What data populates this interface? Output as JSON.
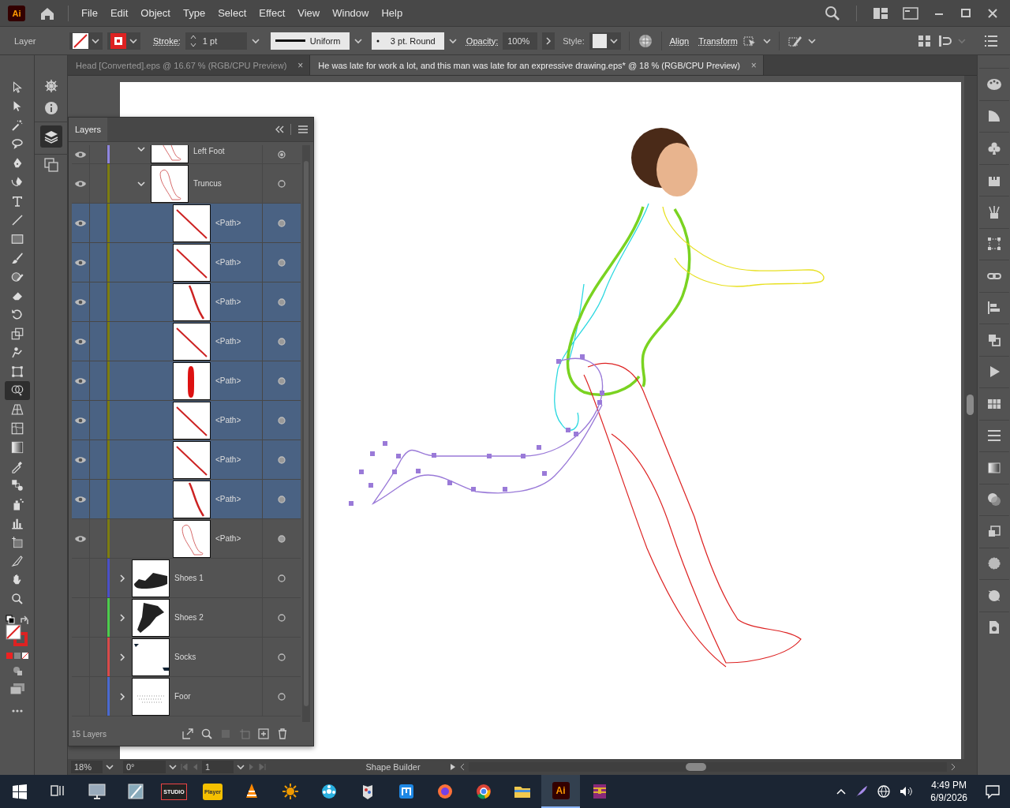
{
  "menu_bar": {
    "logo": "Ai",
    "items": [
      "File",
      "Edit",
      "Object",
      "Type",
      "Select",
      "Effect",
      "View",
      "Window",
      "Help"
    ]
  },
  "control_bar": {
    "selection_label": "Layer",
    "stroke_label": "Stroke:",
    "stroke_weight": "1 pt",
    "profile": "Uniform",
    "brush": "3 pt. Round",
    "opacity_label": "Opacity:",
    "opacity": "100%",
    "style_label": "Style:",
    "align_link": "Align",
    "transform_link": "Transform"
  },
  "tabs": [
    {
      "label": "Head [Converted].eps @ 16.67 % (RGB/CPU Preview)",
      "close": "×",
      "selected": false
    },
    {
      "label": "He was late for work a lot, and this man was late for an expressive drawing.eps* @ 18 % (RGB/CPU Preview)",
      "close": "×",
      "selected": true
    }
  ],
  "tools": [
    {
      "kind": "selection",
      "selected": false
    },
    {
      "kind": "direct-selection",
      "selected": false
    },
    {
      "kind": "magic-wand",
      "selected": false
    },
    {
      "kind": "lasso",
      "selected": false
    },
    {
      "kind": "pen",
      "selected": false
    },
    {
      "kind": "curvature",
      "selected": false
    },
    {
      "kind": "type",
      "selected": false
    },
    {
      "kind": "line",
      "selected": false
    },
    {
      "kind": "rectangle",
      "selected": false
    },
    {
      "kind": "paintbrush",
      "selected": false
    },
    {
      "kind": "shaper",
      "selected": false
    },
    {
      "kind": "eraser",
      "selected": false
    },
    {
      "kind": "rotate",
      "selected": false
    },
    {
      "kind": "scale",
      "selected": false
    },
    {
      "kind": "puppet-warp",
      "selected": false
    },
    {
      "kind": "free-transform",
      "selected": false
    },
    {
      "kind": "shape-builder",
      "selected": true
    },
    {
      "kind": "perspective",
      "selected": false
    },
    {
      "kind": "mesh",
      "selected": false
    },
    {
      "kind": "gradient",
      "selected": false
    },
    {
      "kind": "eyedropper",
      "selected": false
    },
    {
      "kind": "blend",
      "selected": false
    },
    {
      "kind": "symbol-sprayer",
      "selected": false
    },
    {
      "kind": "graph",
      "selected": false
    },
    {
      "kind": "artboard",
      "selected": false
    },
    {
      "kind": "slice",
      "selected": false
    },
    {
      "kind": "hand",
      "selected": false
    },
    {
      "kind": "zoom",
      "selected": false
    }
  ],
  "layers_panel": {
    "title": "Layers",
    "sublayers": [
      {
        "name": "Left Foot",
        "color": "#8f86e0",
        "visible": true,
        "expanded": true,
        "kind": "leg",
        "targeted": true,
        "selected": false
      },
      {
        "name": "Truncus",
        "color": "#7d7d10",
        "visible": true,
        "expanded": true,
        "kind": "leg",
        "targeted": false,
        "selected": false,
        "children": [
          {
            "name": "<Path>",
            "visible": true,
            "kind": "line",
            "targeted": true,
            "selected": true
          },
          {
            "name": "<Path>",
            "visible": true,
            "kind": "line",
            "targeted": true,
            "selected": true
          },
          {
            "name": "<Path>",
            "visible": true,
            "kind": "thick-line",
            "targeted": true,
            "selected": true
          },
          {
            "name": "<Path>",
            "visible": true,
            "kind": "line",
            "targeted": true,
            "selected": true
          },
          {
            "name": "<Path>",
            "visible": true,
            "kind": "blob",
            "targeted": true,
            "selected": true
          },
          {
            "name": "<Path>",
            "visible": true,
            "kind": "line",
            "targeted": true,
            "selected": true
          },
          {
            "name": "<Path>",
            "visible": true,
            "kind": "line",
            "targeted": true,
            "selected": true
          },
          {
            "name": "<Path>",
            "visible": true,
            "kind": "thick-line",
            "targeted": true,
            "selected": true
          },
          {
            "name": "<Path>",
            "visible": true,
            "kind": "leg",
            "targeted": true,
            "selected": false
          }
        ]
      }
    ],
    "layers": [
      {
        "name": "Shoes 1",
        "color": "#4a50c8",
        "visible": false,
        "expanded": false,
        "kind": "shoe",
        "targeted": false,
        "selected": false
      },
      {
        "name": "Shoes 2",
        "color": "#4ccc4c",
        "visible": false,
        "expanded": false,
        "kind": "boot",
        "targeted": false,
        "selected": false
      },
      {
        "name": "Socks",
        "color": "#d94a4a",
        "visible": false,
        "expanded": false,
        "kind": "socks",
        "targeted": false,
        "selected": false
      },
      {
        "name": "Foor",
        "color": "#4a6ad0",
        "visible": false,
        "expanded": false,
        "kind": "scatter",
        "targeted": false,
        "selected": false
      }
    ],
    "count": "15 Layers"
  },
  "status_bar": {
    "zoom": "18%",
    "rotation": "0°",
    "artboard": "1",
    "tool": "Shape Builder"
  },
  "taskbar": {
    "apps": [
      {
        "kind": "task-view",
        "selected": false
      },
      {
        "kind": "monitor",
        "selected": false
      },
      {
        "kind": "pen-tablet",
        "selected": false
      },
      {
        "kind": "studio",
        "label": "STUDIO",
        "selected": false
      },
      {
        "kind": "player",
        "label": "Player",
        "selected": false
      },
      {
        "kind": "cone",
        "selected": false
      },
      {
        "kind": "sun",
        "selected": false
      },
      {
        "kind": "film-reel",
        "selected": false
      },
      {
        "kind": "palette",
        "selected": false
      },
      {
        "kind": "m-square",
        "selected": false
      },
      {
        "kind": "firefox",
        "selected": false
      },
      {
        "kind": "chrome",
        "selected": false
      },
      {
        "kind": "folder",
        "selected": false
      },
      {
        "kind": "ai",
        "label": "Ai",
        "selected": true
      },
      {
        "kind": "archive",
        "selected": false
      }
    ],
    "time": "4:49 PM",
    "date": "6/9/2026"
  }
}
